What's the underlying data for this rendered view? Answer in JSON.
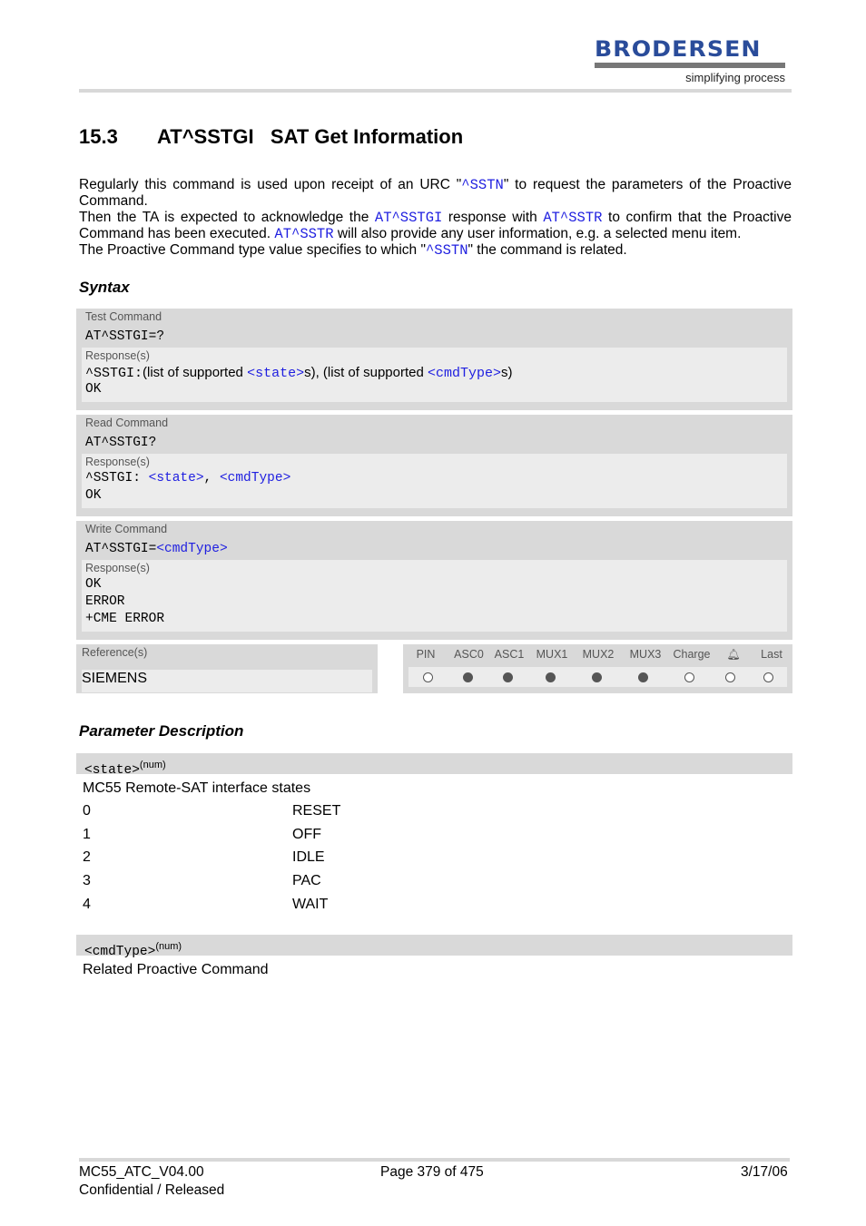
{
  "header": {
    "logo_text": "BRODERSEN",
    "logo_tagline": "simplifying process",
    "brand_color": "#2a4c9a"
  },
  "section": {
    "number": "15.3",
    "title": "AT^SSTGI   SAT Get Information"
  },
  "intro": [
    [
      {
        "t": "Regularly this command is used upon receipt of an URC \""
      },
      {
        "l": "^SSTN"
      },
      {
        "t": "\" to request the parameters of the Proactive Command."
      }
    ],
    [
      {
        "t": "Then the TA is expected to acknowledge the "
      },
      {
        "l": "AT^SSTGI"
      },
      {
        "t": " response with "
      },
      {
        "l": "AT^SSTR"
      },
      {
        "t": " to confirm that the Proactive Command has been executed. "
      },
      {
        "l": "AT^SSTR"
      },
      {
        "t": " will also provide any user information, e.g. a selected menu item."
      }
    ],
    [
      {
        "t": "The Proactive Command type value specifies to which \""
      },
      {
        "l": "^SSTN"
      },
      {
        "t": "\" the command is related."
      }
    ]
  ],
  "syntax": {
    "heading": "Syntax",
    "test": {
      "label": "Test Command",
      "command": "AT^SSTGI=?",
      "response_label": "Response(s)",
      "response_prefix": "^SSTGI:",
      "response_parts": [
        "(list of supported ",
        "<state>",
        "s), (list of supported ",
        "<cmdType>",
        "s)"
      ],
      "ok": "OK"
    },
    "read": {
      "label": "Read Command",
      "command": "AT^SSTGI?",
      "response_label": "Response(s)",
      "response_prefix": "^SSTGI: ",
      "p1": "<state>",
      "sep": ", ",
      "p2": "<cmdType>",
      "ok": "OK"
    },
    "write": {
      "label": "Write Command",
      "command": "AT^SSTGI=",
      "param": "<cmdType>",
      "response_label": "Response(s)",
      "lines": [
        "OK",
        "ERROR",
        "+CME ERROR"
      ]
    }
  },
  "reference": {
    "label": "Reference(s)",
    "value": "SIEMENS"
  },
  "interfaces": {
    "columns": [
      "PIN",
      "ASC0",
      "ASC1",
      "MUX1",
      "MUX2",
      "MUX3",
      "Charge",
      "alarm-icon",
      "Last"
    ],
    "supported": [
      false,
      true,
      true,
      true,
      true,
      true,
      false,
      false,
      false
    ]
  },
  "params": {
    "heading": "Parameter Description",
    "state": {
      "name": "<state>",
      "type": "(num)",
      "desc": "MC55 Remote-SAT interface states",
      "values": [
        [
          "0",
          "RESET"
        ],
        [
          "1",
          "OFF"
        ],
        [
          "2",
          "IDLE"
        ],
        [
          "3",
          "PAC"
        ],
        [
          "4",
          "WAIT"
        ]
      ]
    },
    "cmdType": {
      "name": "<cmdType>",
      "type": "(num)",
      "desc": "Related Proactive Command"
    }
  },
  "footer": {
    "doc": "MC55_ATC_V04.00",
    "status": "Confidential / Released",
    "page": "Page 379 of 475",
    "date": "3/17/06"
  }
}
